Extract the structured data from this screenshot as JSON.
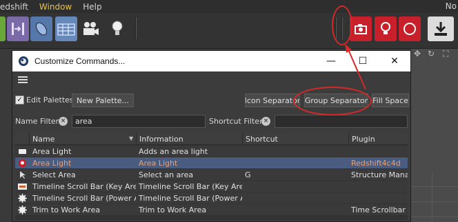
{
  "menubar": {
    "items": [
      "edshift",
      "Window",
      "Help"
    ],
    "right_partial": "No"
  },
  "colors": {
    "accent_menu": "#e8c34a",
    "selected_row": "#4a5d80",
    "highlight_text": "#e8a070",
    "annotation": "#d62828"
  },
  "toolbar": {
    "icons": [
      "redshift-shape-icon",
      "move-tool-icon",
      "capsule-icon",
      "grid-icon",
      "camera-icon",
      "light-bulb-icon",
      "redshift-camera-icon",
      "redshift-light-icon",
      "redshift-sphere-icon",
      "render-download-icon"
    ]
  },
  "dialog": {
    "title": "Customize Commands...",
    "controls": [
      "—",
      "☐",
      "✕"
    ],
    "menu_icon": "hamburger-icon",
    "edit_palettes_label": "Edit Palettes",
    "edit_palettes_checked": true,
    "new_palette_label": "New Palette...",
    "icon_separator_label": "Icon Separator",
    "group_separator_label": "Group Separator",
    "fill_space_label": "Fill Space",
    "name_filter_label": "Name Filter",
    "name_filter_value": "area",
    "shortcut_filter_label": "Shortcut Filter",
    "shortcut_filter_value": ""
  },
  "table": {
    "columns": [
      "Name",
      "Information",
      "Shortcut",
      "Plugin"
    ],
    "rows": [
      {
        "icon": "area-light-icon",
        "name": "Area Light",
        "info": "Adds an area light",
        "shortcut": "",
        "plugin": "",
        "selected": false
      },
      {
        "icon": "redshift-light-icon",
        "name": "Area Light",
        "info": "Area Light",
        "shortcut": "",
        "plugin": "Redshift4c4d",
        "selected": true
      },
      {
        "icon": "select-area-icon",
        "name": "Select Area",
        "info": "Select an area",
        "shortcut": "G",
        "plugin": "Structure Manag",
        "selected": false
      },
      {
        "icon": "timeline-scroll-icon",
        "name": "Timeline Scroll Bar (Key Area)",
        "info": "Timeline Scroll Bar (Key Area)",
        "shortcut": "",
        "plugin": "",
        "selected": false
      },
      {
        "icon": "gear-icon",
        "name": "Timeline Scroll Bar (Power Are",
        "info": "Timeline Scroll Bar (Power Are",
        "shortcut": "",
        "plugin": "",
        "selected": false
      },
      {
        "icon": "gear-icon",
        "name": "Trim to Work Area",
        "info": "Trim to Work Area",
        "shortcut": "",
        "plugin": "Time Scrollbar",
        "selected": false
      }
    ]
  }
}
